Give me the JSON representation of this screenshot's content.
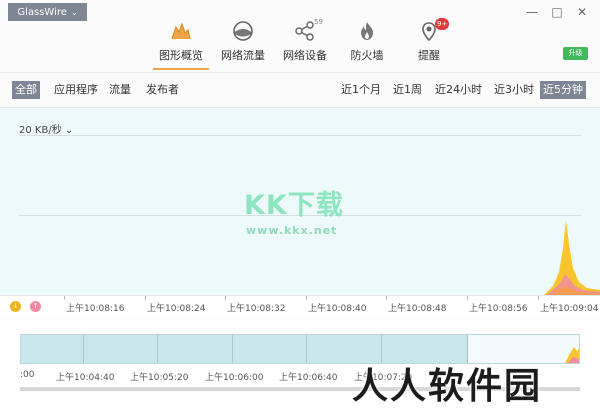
{
  "window": {
    "brand": "GlassWire",
    "controls": [
      "—",
      "□",
      "✕"
    ]
  },
  "nav": [
    {
      "label": "图形概览",
      "icon": "graph-icon",
      "active": true
    },
    {
      "label": "网络流量",
      "icon": "usage-icon"
    },
    {
      "label": "网络设备",
      "icon": "network-devices-icon",
      "count": "59"
    },
    {
      "label": "防火墙",
      "icon": "firewall-icon"
    },
    {
      "label": "提醒",
      "icon": "alerts-icon",
      "badge": "9+"
    }
  ],
  "upgrade_label": "升级",
  "filters": {
    "left": [
      "全部",
      "应用程序",
      "流量",
      "发布者"
    ],
    "right": [
      "近1个月",
      "近1周",
      "近24小时",
      "近3小时",
      "近5分钟"
    ],
    "active_left": "全部",
    "active_right": "近5分钟"
  },
  "graph": {
    "scale_label": "20 KB/秒",
    "watermark_main": "KK下载",
    "watermark_url": "www.kkx.net"
  },
  "timeline": {
    "ticks": [
      "上午10:08:16",
      "上午10:08:24",
      "上午10:08:32",
      "上午10:08:40",
      "上午10:08:48",
      "上午10:08:56",
      "上午10:09:04"
    ]
  },
  "overview": {
    "ticks": [
      ":00",
      "上午10:04:40",
      "上午10:05:20",
      "上午10:06:00",
      "上午10:06:40",
      "上午10:07:20"
    ]
  },
  "watermark_bottom": "人人软件园",
  "colors": {
    "accent": "#f0a54a",
    "brand_bg": "#7d8694",
    "upgrade": "#3fba5a",
    "graph_bg": "#eef9fb",
    "incoming": "#f7c62f",
    "outgoing": "#f08aa0"
  }
}
